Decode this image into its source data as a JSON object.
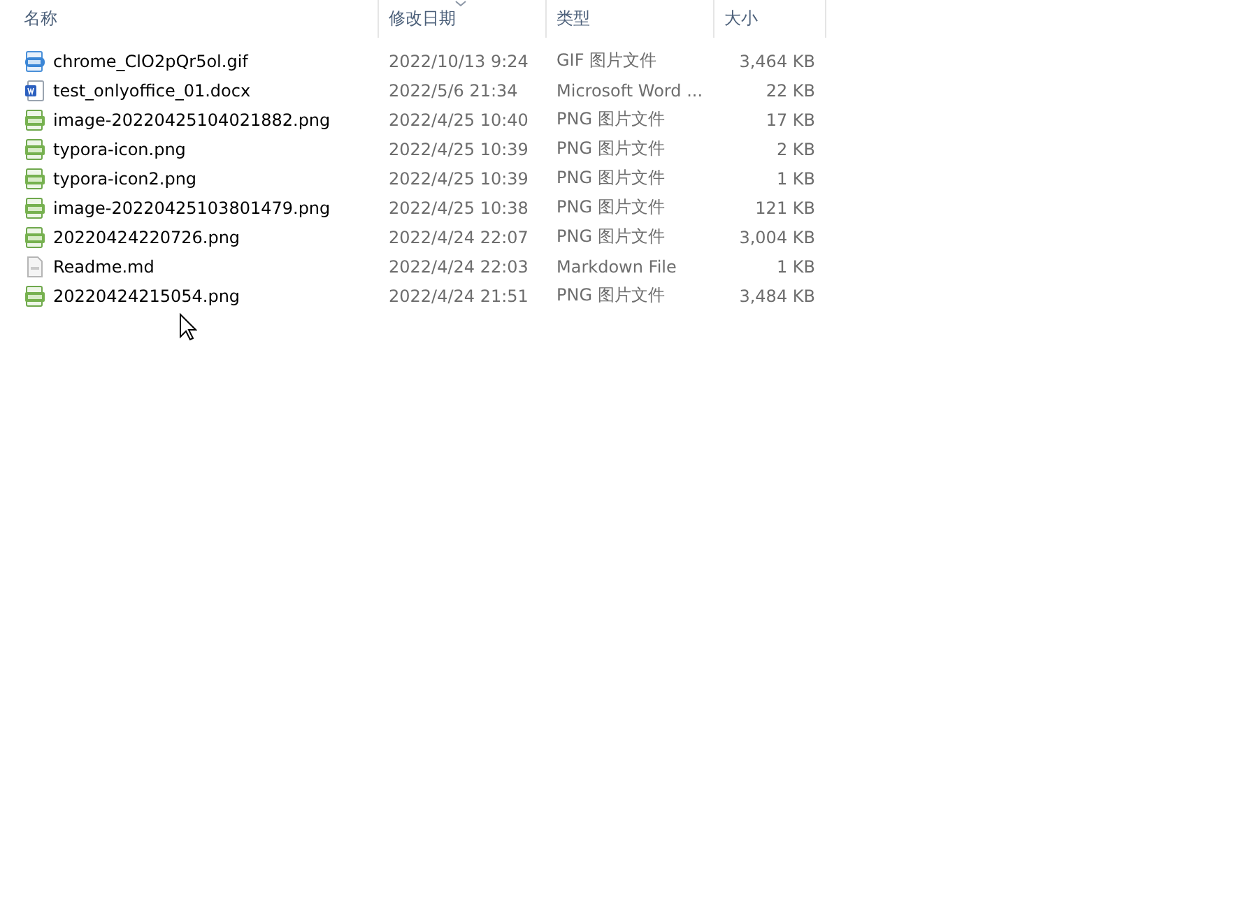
{
  "columns": [
    {
      "label": "名称",
      "sorted": false
    },
    {
      "label": "修改日期",
      "sorted": true
    },
    {
      "label": "类型",
      "sorted": false
    },
    {
      "label": "大小",
      "sorted": false
    }
  ],
  "files": [
    {
      "kind": "gif",
      "name": "chrome_ClO2pQr5ol.gif",
      "date": "2022/10/13 9:24",
      "type": "GIF 图片文件",
      "size": "3,464 KB"
    },
    {
      "kind": "docx",
      "name": "test_onlyoffice_01.docx",
      "date": "2022/5/6 21:34",
      "type": "Microsoft Word ...",
      "size": "22 KB"
    },
    {
      "kind": "png",
      "name": "image-20220425104021882.png",
      "date": "2022/4/25 10:40",
      "type": "PNG 图片文件",
      "size": "17 KB"
    },
    {
      "kind": "png",
      "name": "typora-icon.png",
      "date": "2022/4/25 10:39",
      "type": "PNG 图片文件",
      "size": "2 KB"
    },
    {
      "kind": "png",
      "name": "typora-icon2.png",
      "date": "2022/4/25 10:39",
      "type": "PNG 图片文件",
      "size": "1 KB"
    },
    {
      "kind": "png",
      "name": "image-20220425103801479.png",
      "date": "2022/4/25 10:38",
      "type": "PNG 图片文件",
      "size": "121 KB"
    },
    {
      "kind": "png",
      "name": "20220424220726.png",
      "date": "2022/4/24 22:07",
      "type": "PNG 图片文件",
      "size": "3,004 KB"
    },
    {
      "kind": "md",
      "name": "Readme.md",
      "date": "2022/4/24 22:03",
      "type": "Markdown File",
      "size": "1 KB"
    },
    {
      "kind": "png",
      "name": "20220424215054.png",
      "date": "2022/4/24 21:51",
      "type": "PNG 图片文件",
      "size": "3,484 KB"
    }
  ]
}
